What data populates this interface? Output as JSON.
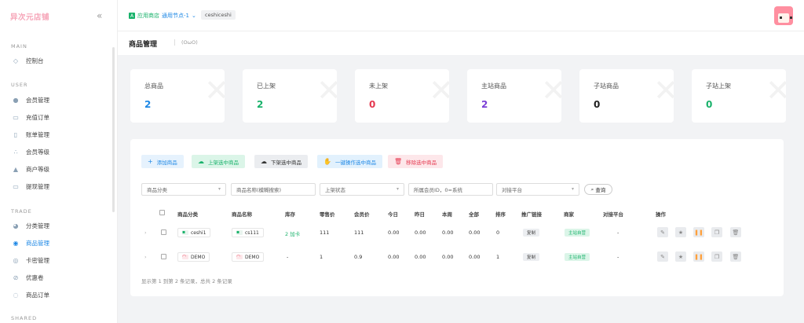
{
  "brand": "异次元店铺",
  "sidebar": {
    "sections": [
      "MAIN",
      "USER",
      "TRADE",
      "SHARED"
    ],
    "items": [
      {
        "label": "控制台",
        "icon": "dashboard-icon"
      },
      {
        "label": "会员管理",
        "icon": "user-icon"
      },
      {
        "label": "充值订单",
        "icon": "recharge-icon"
      },
      {
        "label": "账单管理",
        "icon": "bill-icon"
      },
      {
        "label": "会员等级",
        "icon": "level-icon"
      },
      {
        "label": "商户等级",
        "icon": "merchant-icon"
      },
      {
        "label": "提现管理",
        "icon": "withdraw-icon"
      },
      {
        "label": "分类管理",
        "icon": "category-icon"
      },
      {
        "label": "商品管理",
        "icon": "goods-icon",
        "active": true
      },
      {
        "label": "卡密管理",
        "icon": "card-icon"
      },
      {
        "label": "优惠卷",
        "icon": "coupon-icon"
      },
      {
        "label": "商品订单",
        "icon": "order-icon"
      }
    ]
  },
  "topbar": {
    "store": "应用商店",
    "node": "通用节点-1",
    "user": "ceshiceshi"
  },
  "page": {
    "title": "商品管理",
    "subtitle": "(OωO)"
  },
  "stats": [
    {
      "label": "总商品",
      "value": "2",
      "color": "#1e88e5"
    },
    {
      "label": "已上架",
      "value": "2",
      "color": "#19b26b"
    },
    {
      "label": "未上架",
      "value": "0",
      "color": "#e53950"
    },
    {
      "label": "主站商品",
      "value": "2",
      "color": "#7b3fd6"
    },
    {
      "label": "子站商品",
      "value": "0",
      "color": "#222222"
    },
    {
      "label": "子站上架",
      "value": "0",
      "color": "#19b26b"
    }
  ],
  "toolbar": {
    "add": "添加商品",
    "shelf_up": "上架选中商品",
    "shelf_down": "下架选中商品",
    "one_click": "一键操作选中商品",
    "remove": "移除选中商品"
  },
  "filters": {
    "category": "商品分类",
    "name": "商品名称(模糊搜索)",
    "status": "上架状态",
    "member": "所属会员ID，0=系统",
    "platform": "对接平台",
    "search": "查询"
  },
  "table": {
    "headers": [
      "商品分类",
      "商品名称",
      "库存",
      "零售价",
      "会员价",
      "今日",
      "昨日",
      "本周",
      "全部",
      "排序",
      "推广链接",
      "商家",
      "对接平台",
      "操作"
    ],
    "rows": [
      {
        "category": "ceshi1",
        "name": "cs111",
        "stock": "2 加卡",
        "retail": "111",
        "member": "111",
        "today": "0.00",
        "yesterday": "0.00",
        "week": "0.00",
        "all": "0.00",
        "sort": "0",
        "link": "复制",
        "merchant": "主站自营",
        "platform": "-"
      },
      {
        "category": "DEMO",
        "name": "DEMO",
        "stock": "-",
        "retail": "1",
        "member": "0.9",
        "today": "0.00",
        "yesterday": "0.00",
        "week": "0.00",
        "all": "0.00",
        "sort": "1",
        "link": "复制",
        "merchant": "主站自营",
        "platform": "-"
      }
    ],
    "footer": "显示第 1 到第 2 条记录，总共 2 条记录"
  }
}
